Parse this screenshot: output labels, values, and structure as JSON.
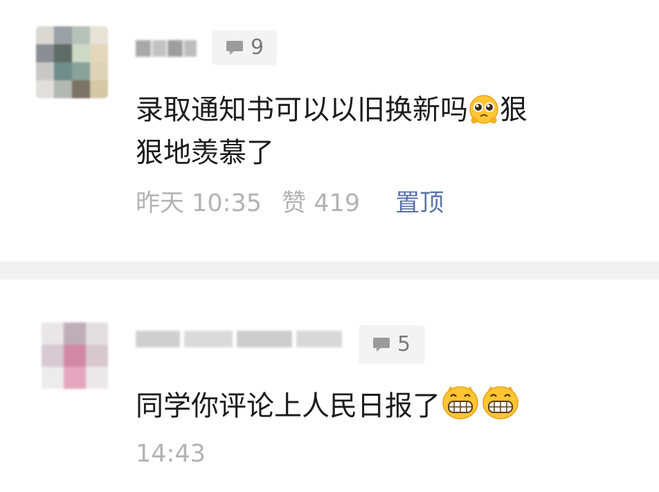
{
  "comments": [
    {
      "reply_count": "9",
      "content_line1": "录取通知书可以以旧换新吗",
      "content_after_emoji": "狠",
      "content_line2": "狠地羡慕了",
      "time": "昨天 10:35",
      "likes_label": "赞",
      "likes": "419",
      "pin_label": "置顶",
      "emoji": "pleading-face"
    },
    {
      "reply_count": "5",
      "content": "同学你评论上人民日报了",
      "time": "14:43",
      "emoji": "grinning-face"
    }
  ],
  "colors": {
    "divider": "#f1f1f1",
    "pin_link": "#5a73a8",
    "meta_text": "#b3b3b3"
  }
}
